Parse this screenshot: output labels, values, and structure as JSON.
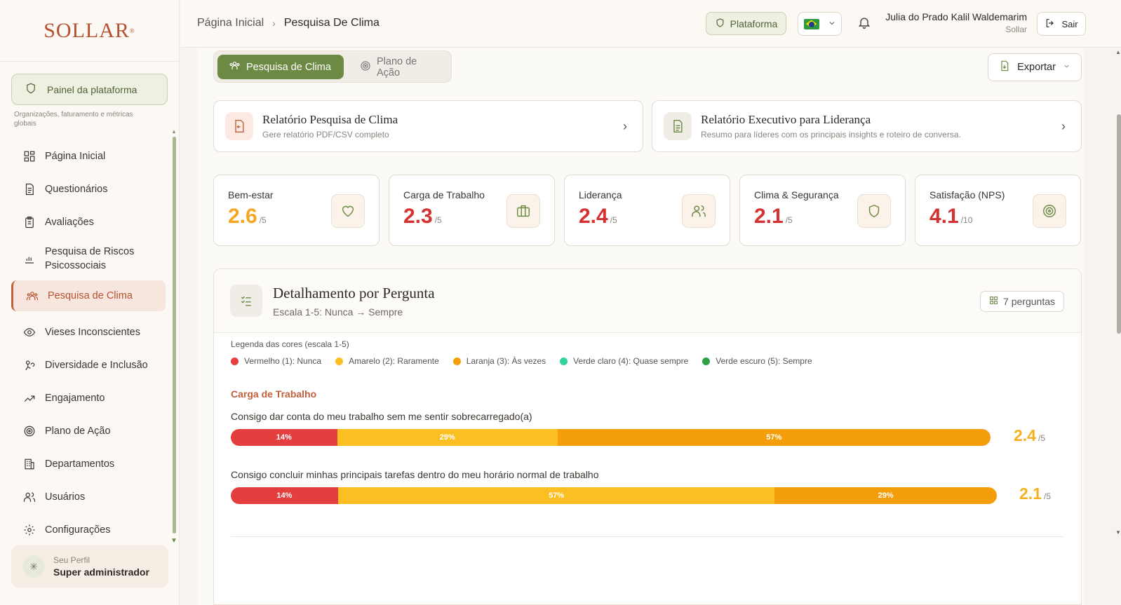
{
  "brand": {
    "logo": "SOLLAR",
    "logo_mark": "®"
  },
  "sidebar": {
    "panel_button": "Painel da plataforma",
    "panel_desc": "Organizações, faturamento e métricas globais",
    "items": [
      {
        "label": "Página Inicial",
        "icon": "grid-icon"
      },
      {
        "label": "Questionários",
        "icon": "document-icon"
      },
      {
        "label": "Avaliações",
        "icon": "clipboard-icon"
      },
      {
        "label": "Pesquisa de Riscos Psicossociais",
        "icon": "bar-chart-icon"
      },
      {
        "label": "Pesquisa de Clima",
        "icon": "people-group-icon"
      },
      {
        "label": "Vieses Inconscientes",
        "icon": "eye-icon"
      },
      {
        "label": "Diversidade e Inclusão",
        "icon": "diversity-icon"
      },
      {
        "label": "Engajamento",
        "icon": "trending-up-icon"
      },
      {
        "label": "Plano de Ação",
        "icon": "target-icon"
      },
      {
        "label": "Departamentos",
        "icon": "building-icon"
      },
      {
        "label": "Usuários",
        "icon": "users-icon"
      },
      {
        "label": "Configurações",
        "icon": "gear-icon"
      }
    ],
    "active_index": 4,
    "profile": {
      "label": "Seu Perfil",
      "value": "Super administrador"
    }
  },
  "header": {
    "breadcrumb": [
      "Página Inicial",
      "Pesquisa De Clima"
    ],
    "platform_button": "Plataforma",
    "language": "pt-BR",
    "user_name": "Julia do Prado Kalil Waldemarim",
    "user_org": "Sollar",
    "logout": "Sair"
  },
  "tabs": [
    {
      "label": "Pesquisa de Clima",
      "active": true
    },
    {
      "label": "Plano de Ação",
      "active": false
    }
  ],
  "export_button": "Exportar",
  "reports": [
    {
      "title": "Relatório Pesquisa de Clima",
      "subtitle": "Gere relatório PDF/CSV completo"
    },
    {
      "title": "Relatório Executivo para Liderança",
      "subtitle": "Resumo para líderes com os principais insights e roteiro de conversa."
    }
  ],
  "kpis": [
    {
      "label": "Bem-estar",
      "value": "2.6",
      "scale": "/5",
      "color": "#f5a623",
      "icon": "heart-icon"
    },
    {
      "label": "Carga de Trabalho",
      "value": "2.3",
      "scale": "/5",
      "color": "#d63131",
      "icon": "briefcase-icon"
    },
    {
      "label": "Liderança",
      "value": "2.4",
      "scale": "/5",
      "color": "#d63131",
      "icon": "users-icon"
    },
    {
      "label": "Clima & Segurança",
      "value": "2.1",
      "scale": "/5",
      "color": "#d63131",
      "icon": "shield-icon"
    },
    {
      "label": "Satisfação (NPS)",
      "value": "4.1",
      "scale": "/10",
      "color": "#d63131",
      "icon": "target-icon"
    }
  ],
  "detail": {
    "title": "Detalhamento por Pergunta",
    "subtitle": "Escala 1-5: Nunca → Sempre",
    "count": "7 perguntas",
    "legend_title": "Legenda das cores (escala 1-5)",
    "legend": [
      {
        "label": "Vermelho (1): Nunca",
        "color": "#e53e3e"
      },
      {
        "label": "Amarelo (2): Raramente",
        "color": "#fbbf24"
      },
      {
        "label": "Laranja (3): Às vezes",
        "color": "#f59e0b"
      },
      {
        "label": "Verde claro (4): Quase sempre",
        "color": "#34d399"
      },
      {
        "label": "Verde escuro (5): Sempre",
        "color": "#2f9e44"
      }
    ],
    "section": "Carga de Trabalho",
    "questions": [
      {
        "text": "Consigo dar conta do meu trabalho sem me sentir sobrecarregado(a)",
        "segments": [
          {
            "label": "14%",
            "pct": 14,
            "color": "#e53e3e"
          },
          {
            "label": "29%",
            "pct": 29,
            "color": "#fbbf24"
          },
          {
            "label": "57%",
            "pct": 57,
            "color": "#f59e0b"
          }
        ],
        "score": "2.4",
        "scale": "/5"
      },
      {
        "text": "Consigo concluir minhas principais tarefas dentro do meu horário normal de trabalho",
        "segments": [
          {
            "label": "14%",
            "pct": 14,
            "color": "#e53e3e"
          },
          {
            "label": "57%",
            "pct": 57,
            "color": "#fbbf24"
          },
          {
            "label": "29%",
            "pct": 29,
            "color": "#f59e0b"
          }
        ],
        "score": "2.1",
        "scale": "/5"
      }
    ]
  }
}
